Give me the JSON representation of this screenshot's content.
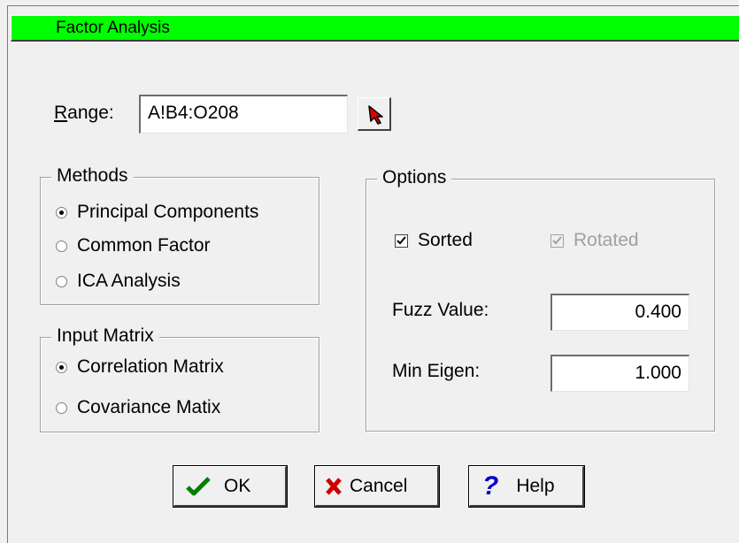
{
  "window": {
    "title": "Factor Analysis"
  },
  "range": {
    "label": "Range:",
    "value": "A!B4:O208",
    "picker_icon": "arrow-cursor-icon"
  },
  "methods": {
    "title": "Methods",
    "options": [
      {
        "label": "Principal Components",
        "selected": true
      },
      {
        "label": "Common Factor",
        "selected": false
      },
      {
        "label": "ICA Analysis",
        "selected": false
      }
    ]
  },
  "input_matrix": {
    "title": "Input Matrix",
    "options": [
      {
        "label": "Correlation Matrix",
        "selected": true
      },
      {
        "label": "Covariance Matix",
        "selected": false
      }
    ]
  },
  "options": {
    "title": "Options",
    "sorted": {
      "label": "Sorted",
      "checked": true,
      "enabled": true
    },
    "rotated": {
      "label": "Rotated",
      "checked": true,
      "enabled": false
    },
    "fuzz": {
      "label": "Fuzz Value:",
      "value": "0.400"
    },
    "min_eigen": {
      "label": "Min Eigen:",
      "value": "1.000"
    }
  },
  "buttons": {
    "ok": {
      "label": "OK",
      "icon": "checkmark-icon"
    },
    "cancel": {
      "label": "Cancel",
      "icon": "x-icon"
    },
    "help": {
      "label": "Help",
      "icon": "question-mark-icon"
    }
  },
  "colors": {
    "titlebar": "#00ff00",
    "ok_icon": "#008000",
    "cancel_icon": "#cc0000",
    "help_icon": "#0000cc"
  }
}
